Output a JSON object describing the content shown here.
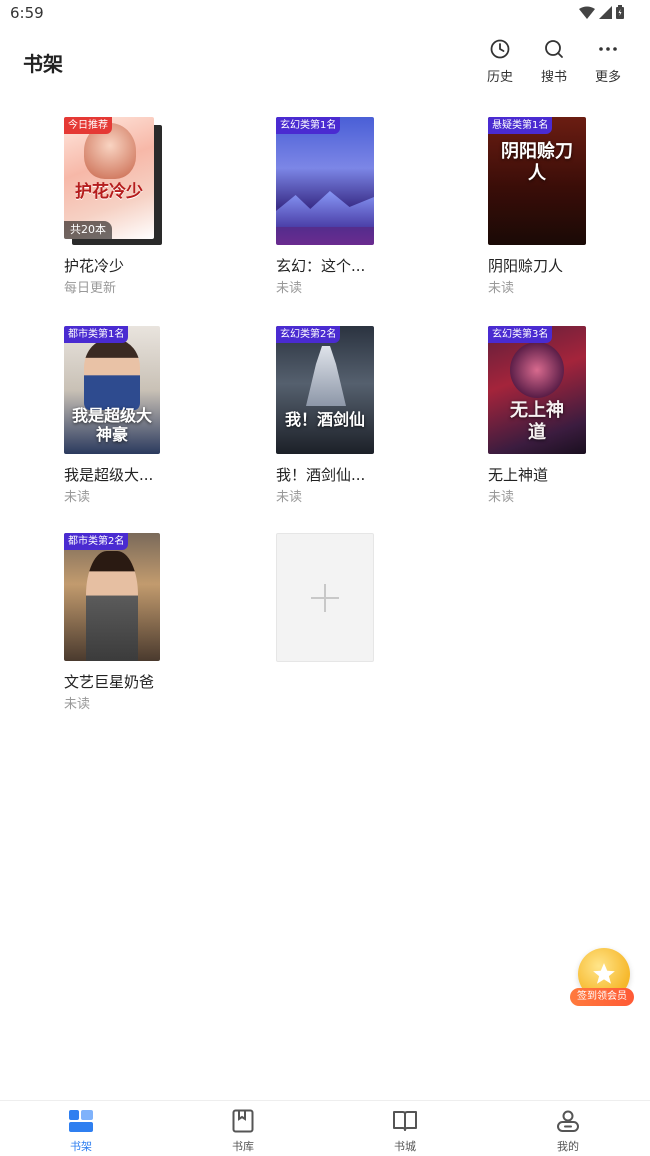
{
  "status": {
    "time": "6:59"
  },
  "header": {
    "title": "书架",
    "actions": [
      {
        "label": "历史",
        "icon": "history-icon"
      },
      {
        "label": "搜书",
        "icon": "search-icon"
      },
      {
        "label": "更多",
        "icon": "more-icon"
      }
    ]
  },
  "books": [
    {
      "title": "护花冷少",
      "status": "每日更新",
      "badge": "今日推荐",
      "count": "共20本",
      "cover_text": "护花冷少"
    },
    {
      "title": "玄幻：这个...",
      "status": "未读",
      "badge": "玄幻类第1名"
    },
    {
      "title": "阴阳赊刀人",
      "status": "未读",
      "badge": "悬疑类第1名",
      "cover_text": "阴阳赊刀人"
    },
    {
      "title": "我是超级大...",
      "status": "未读",
      "badge": "都市类第1名",
      "cover_text": "我是超级大神豪"
    },
    {
      "title": "我！酒剑仙...",
      "status": "未读",
      "badge": "玄幻类第2名",
      "cover_text": "我！酒剑仙"
    },
    {
      "title": "无上神道",
      "status": "未读",
      "badge": "玄幻类第3名",
      "cover_text": "无上神道"
    },
    {
      "title": "文艺巨星奶爸",
      "status": "未读",
      "badge": "都市类第2名"
    }
  ],
  "vip": {
    "label": "签到领会员"
  },
  "tabs": [
    {
      "label": "书架",
      "icon": "bookshelf-icon",
      "active": true
    },
    {
      "label": "书库",
      "icon": "library-icon"
    },
    {
      "label": "书城",
      "icon": "bookstore-icon"
    },
    {
      "label": "我的",
      "icon": "profile-icon"
    }
  ],
  "colors": {
    "accent": "#2f7ff0",
    "badge": "#4a2bd1",
    "badge_red": "#e53935"
  }
}
